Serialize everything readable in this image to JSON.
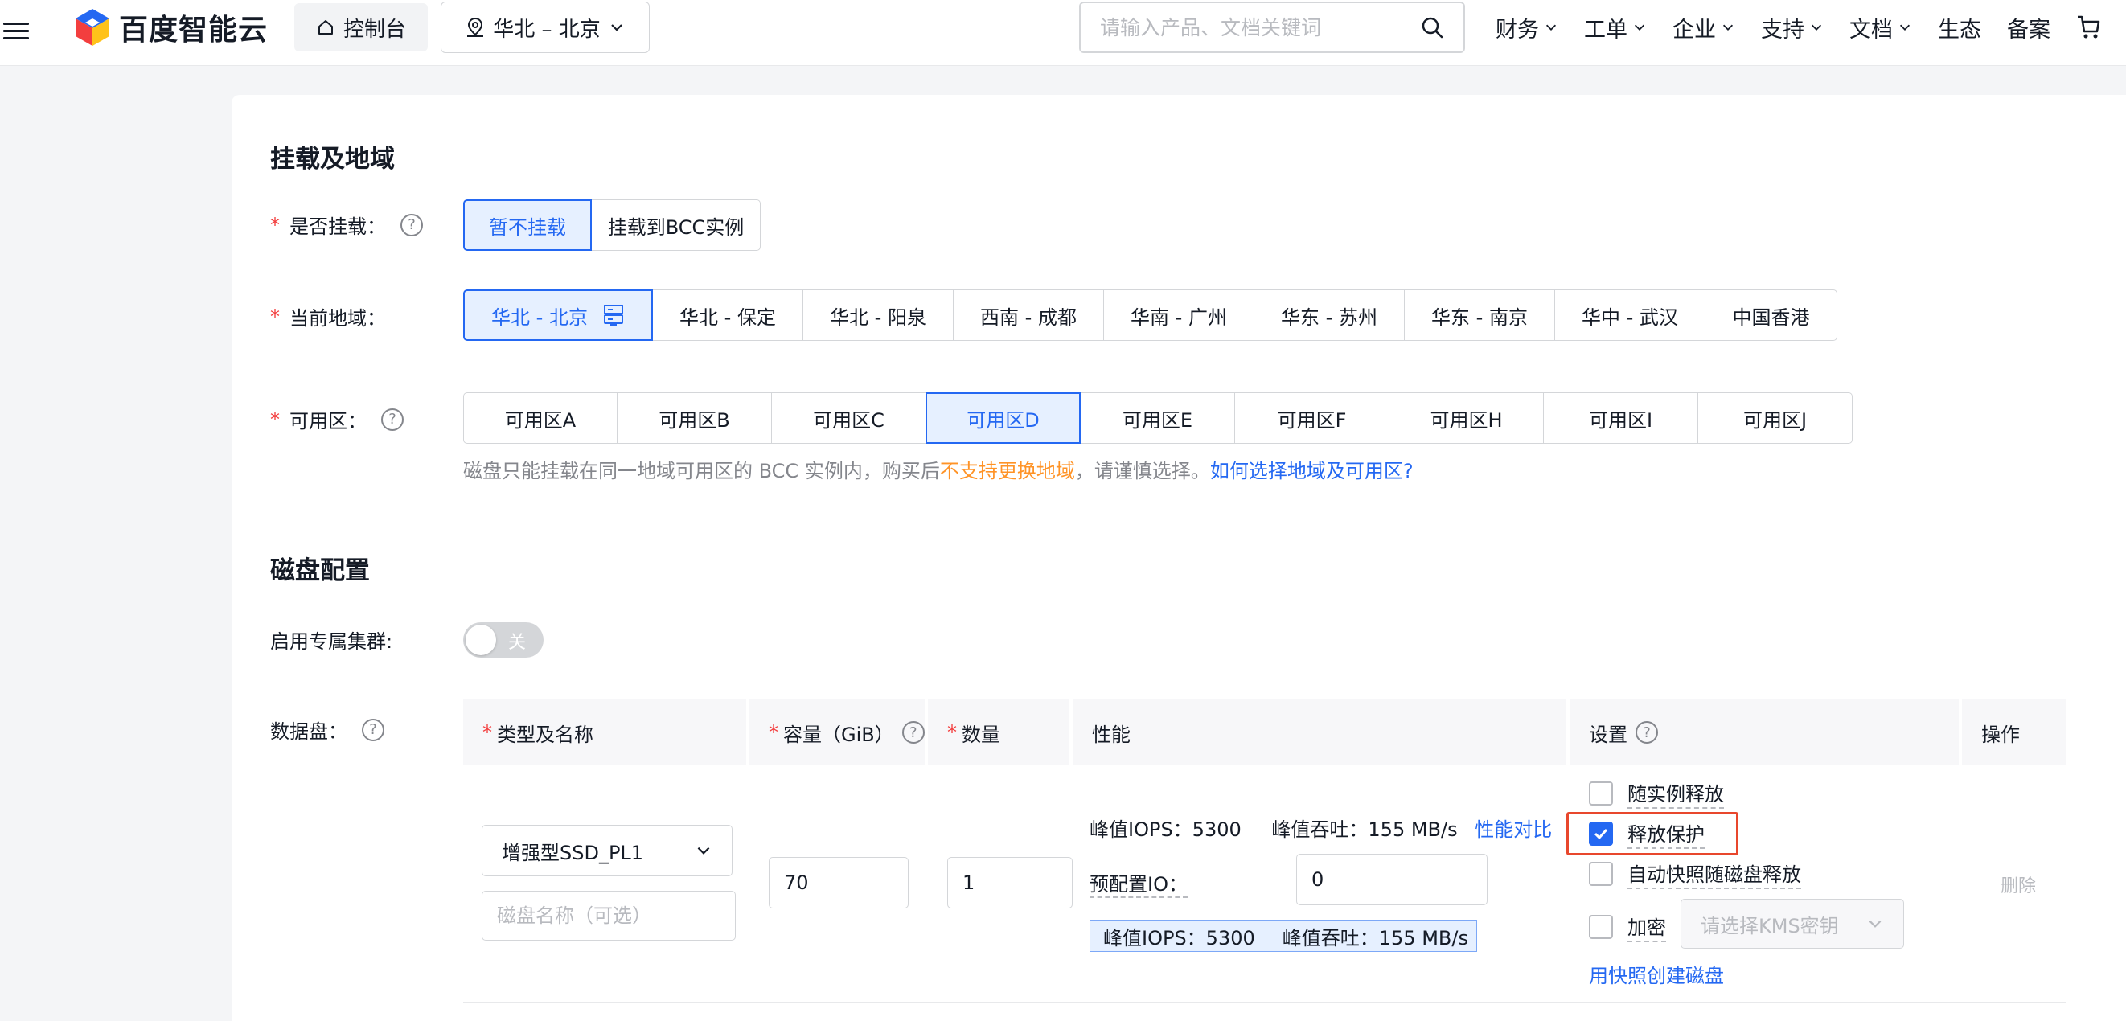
{
  "topbar": {
    "logo_text": "百度智能云",
    "console_label": "控制台",
    "region_label": "华北 – 北京",
    "search_placeholder": "请输入产品、文档关键词",
    "nav": [
      {
        "label": "财务",
        "has_menu": true
      },
      {
        "label": "工单",
        "has_menu": true
      },
      {
        "label": "企业",
        "has_menu": true
      },
      {
        "label": "支持",
        "has_menu": true
      },
      {
        "label": "文档",
        "has_menu": true
      },
      {
        "label": "生态",
        "has_menu": false
      },
      {
        "label": "备案",
        "has_menu": false
      }
    ]
  },
  "mount_section": {
    "title": "挂载及地域",
    "mount_label": "是否挂载：",
    "mount_options": [
      "暂不挂载",
      "挂载到BCC实例"
    ],
    "mount_selected": "暂不挂载",
    "region_label": "当前地域：",
    "regions": [
      "华北 - 北京",
      "华北 - 保定",
      "华北 - 阳泉",
      "西南 - 成都",
      "华南 - 广州",
      "华东 - 苏州",
      "华东 - 南京",
      "华中 - 武汉",
      "中国香港"
    ],
    "region_selected": "华北 - 北京",
    "zone_label": "可用区：",
    "zones": [
      "可用区A",
      "可用区B",
      "可用区C",
      "可用区D",
      "可用区E",
      "可用区F",
      "可用区H",
      "可用区I",
      "可用区J"
    ],
    "zone_selected": "可用区D",
    "hint_pre": "磁盘只能挂载在同一地域可用区的 BCC 实例内，购买后",
    "hint_warn": "不支持更换地域",
    "hint_mid": "，请谨慎选择。",
    "hint_link": "如何选择地域及可用区?"
  },
  "disk_section": {
    "title": "磁盘配置",
    "dedicated_label": "启用专属集群:",
    "toggle_text": "关",
    "data_disk_label": "数据盘：",
    "columns": {
      "type": "类型及名称",
      "capacity": "容量（GiB）",
      "quantity": "数量",
      "performance": "性能",
      "settings": "设置",
      "action": "操作"
    },
    "row": {
      "disk_type": "增强型SSD_PL1",
      "name_placeholder": "磁盘名称（可选）",
      "capacity": "70",
      "quantity": "1",
      "peak_iops": "峰值IOPS：5300",
      "peak_throughput": "峰值吞吐：155 MB/s",
      "compare_link": "性能对比",
      "provision_label": "预配置IO：",
      "provision_value": "0",
      "tag_iops": "峰值IOPS：5300",
      "tag_throughput": "峰值吞吐：155 MB/s",
      "opt_release_with_instance": "随实例释放",
      "opt_release_protect": "释放保护",
      "opt_auto_snapshot": "自动快照随磁盘释放",
      "opt_encrypt": "加密",
      "kms_placeholder": "请选择KMS密钥",
      "snapshot_link": "用快照创建磁盘",
      "delete": "删除",
      "checks": {
        "release_with_instance": false,
        "release_protect": true,
        "auto_snapshot": false,
        "encrypt": false
      }
    }
  },
  "colors": {
    "primary": "#2468f2",
    "selected_bg": "#e6f0ff",
    "required": "#f33e3e",
    "warn": "#ff9326",
    "highlight_box": "#e8472d"
  }
}
